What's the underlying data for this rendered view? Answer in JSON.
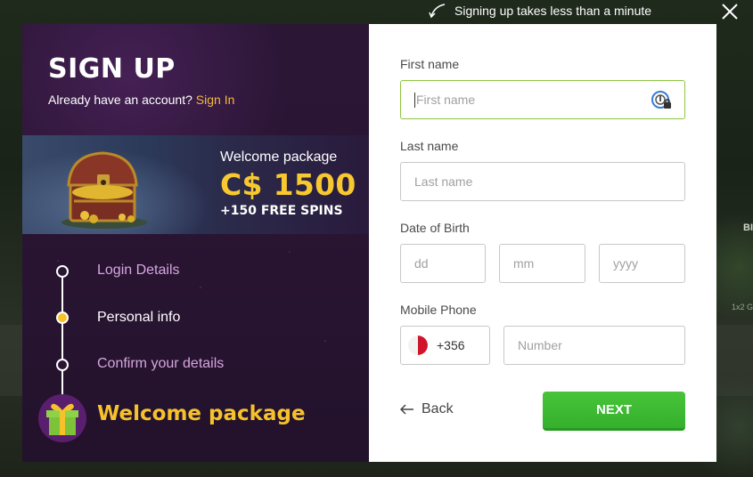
{
  "hint": {
    "text": "Signing up takes less than a minute"
  },
  "background": {
    "right_label": "BI",
    "right_small": "1x2 G"
  },
  "left": {
    "title": "SIGN UP",
    "account_prompt": "Already have an account?",
    "signin_link": "Sign In",
    "promo": {
      "title": "Welcome package",
      "amount": "C$ 1500",
      "spins": "+150 FREE SPINS"
    },
    "steps": [
      {
        "label": "Login Details",
        "state": "pending"
      },
      {
        "label": "Personal info",
        "state": "current"
      },
      {
        "label": "Confirm your details",
        "state": "pending"
      }
    ],
    "bonus_label": "Welcome package"
  },
  "form": {
    "first_name": {
      "label": "First name",
      "placeholder": "First name",
      "value": ""
    },
    "last_name": {
      "label": "Last name",
      "placeholder": "Last name",
      "value": ""
    },
    "dob": {
      "label": "Date of Birth",
      "day_placeholder": "dd",
      "month_placeholder": "mm",
      "year_placeholder": "yyyy"
    },
    "phone": {
      "label": "Mobile Phone",
      "country_code": "+356",
      "number_placeholder": "Number"
    },
    "back_label": "Back",
    "next_label": "NEXT"
  },
  "colors": {
    "accent_yellow": "#f6c22b",
    "signin_link": "#f6b93b",
    "next_button": "#3ab530",
    "focused_border": "#8cc63e",
    "pending_step": "#d7a6e0"
  },
  "icons": [
    "arrow-hint-icon",
    "close-icon",
    "treasure-chest-icon",
    "gift-icon",
    "password-manager-icon",
    "malta-flag-icon",
    "back-arrow-icon"
  ]
}
